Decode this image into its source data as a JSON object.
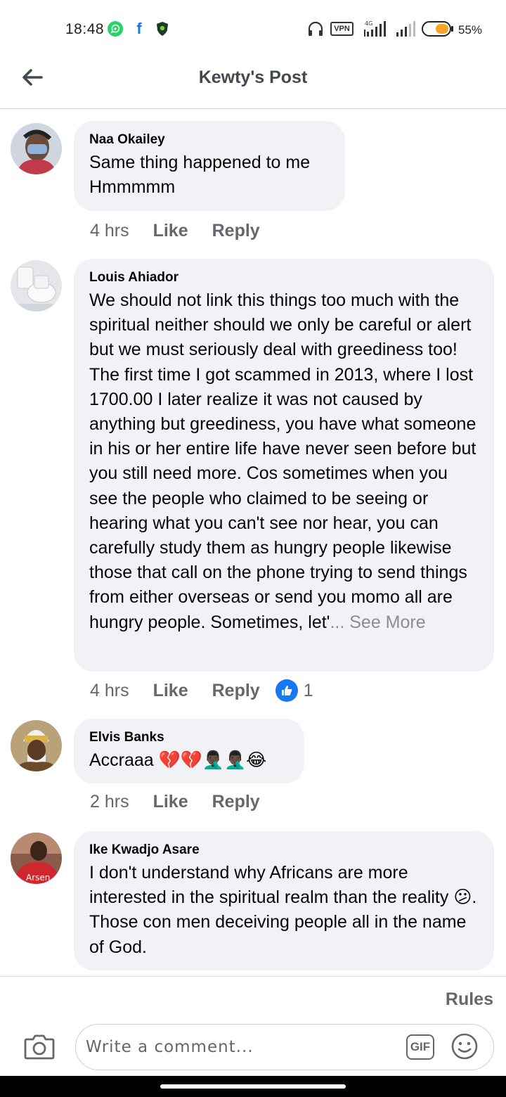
{
  "status_bar": {
    "time": "18:48",
    "vpn": "VPN",
    "battery_percent": "55%",
    "icons": [
      "whatsapp-icon",
      "facebook-icon",
      "shield-icon",
      "headset-icon",
      "vpn-icon",
      "signal-4g-icon",
      "signal-icon",
      "battery-icon"
    ]
  },
  "header": {
    "title": "Kewty's Post",
    "back_icon": "arrow-left-icon"
  },
  "comments": [
    {
      "author": "Naa Okailey",
      "text": "Same thing happened to me Hmmmmm",
      "time": "4 hrs",
      "like": "Like",
      "reply": "Reply"
    },
    {
      "author": "Louis Ahiador",
      "text": "We should not link this things too much with the spiritual neither should we only be careful or alert but we must seriously deal with greediness too! The first time I got scammed in 2013, where I lost 1700.00 I later realize it was not caused by anything but greediness, you have what someone in his or her entire life have never seen before but you still need more. Cos sometimes when you see the people who claimed to be seeing or hearing what you can't see nor hear, you can carefully study them as hungry people likewise those that call on the phone trying to send things from either overseas or send you momo all are hungry people. Sometimes, let'",
      "see_more": "... See More",
      "time": "4 hrs",
      "like": "Like",
      "reply": "Reply",
      "reaction_count": "1"
    },
    {
      "author": "Elvis Banks",
      "text": "Accraaa 💔💔🤦🏿‍♂️🤦🏿‍♂️😂",
      "time": "2 hrs",
      "like": "Like",
      "reply": "Reply"
    },
    {
      "author": "Ike Kwadjo Asare",
      "text": "I don't understand why Africans are more interested in the spiritual realm than the reality 😕.  Those con men  deceiving people all in the name of God.",
      "avatar_text": "Arsen"
    }
  ],
  "footer": {
    "rules": "Rules",
    "placeholder": "Write a comment...",
    "gif": "GIF"
  },
  "colors": {
    "bubble": "#f0f2f5",
    "meta_text": "#65676b",
    "like_blue": "#1877f2",
    "whatsapp_green": "#25d366"
  }
}
